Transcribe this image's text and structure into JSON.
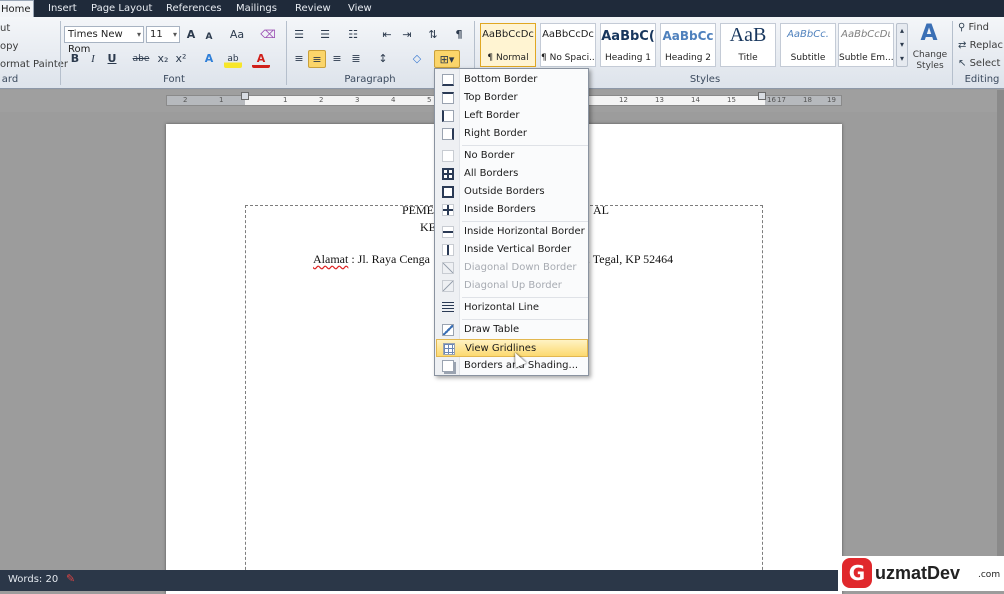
{
  "tabs": [
    "Home",
    "Insert",
    "Page Layout",
    "References",
    "Mailings",
    "Review",
    "View"
  ],
  "clipboard": {
    "cut": "ut",
    "copy": "opy",
    "format_painter": "ormat Painter",
    "label": "ard"
  },
  "font": {
    "name": "Times New Rom",
    "size": "11",
    "label": "Font",
    "bold": "B",
    "italic": "I",
    "underline": "U",
    "strike": "abe",
    "sub": "x₂",
    "sup": "x²",
    "grow": "A",
    "shrink": "A",
    "change_case": "Aa",
    "clear": "A",
    "highlight": "ab",
    "color": "A"
  },
  "paragraph": {
    "label": "Paragraph",
    "pilcrow": "¶"
  },
  "styles": {
    "label": "Styles",
    "items": [
      {
        "preview": "AaBbCcDc",
        "name": "¶ Normal"
      },
      {
        "preview": "AaBbCcDc",
        "name": "¶ No Spaci..."
      },
      {
        "preview": "AaBbC(",
        "name": "Heading 1"
      },
      {
        "preview": "AaBbCc",
        "name": "Heading 2"
      },
      {
        "preview": "AaB",
        "name": "Title"
      },
      {
        "preview": "AaBbCc.",
        "name": "Subtitle"
      },
      {
        "preview": "AaBbCcDι",
        "name": "Subtle Em..."
      }
    ],
    "change_styles": "Change Styles"
  },
  "editing": {
    "label": "Editing",
    "find": "Find",
    "replace": "Replac",
    "select": "Select"
  },
  "ruler_numbers": [
    "2",
    "1",
    "1",
    "2",
    "3",
    "4",
    "5",
    "6",
    "12",
    "13",
    "14",
    "15",
    "16",
    "17",
    "18",
    "19"
  ],
  "document": {
    "line1_left": "PEME",
    "line1_right": "AL",
    "line2_left": "KE",
    "line3_left": "Alamat",
    "line3_mid": " : Jl. Raya Cenga",
    "line3_right": "b. Tegal, KP 52464"
  },
  "border_menu": {
    "items": [
      {
        "label": "Bottom Border",
        "enabled": true
      },
      {
        "label": "Top Border",
        "enabled": true
      },
      {
        "label": "Left Border",
        "enabled": true
      },
      {
        "label": "Right Border",
        "enabled": true
      },
      {
        "label": "No Border",
        "enabled": true
      },
      {
        "label": "All Borders",
        "enabled": true
      },
      {
        "label": "Outside Borders",
        "enabled": true
      },
      {
        "label": "Inside Borders",
        "enabled": true
      },
      {
        "label": "Inside Horizontal Border",
        "enabled": true
      },
      {
        "label": "Inside Vertical Border",
        "enabled": true
      },
      {
        "label": "Diagonal Down Border",
        "enabled": false
      },
      {
        "label": "Diagonal Up Border",
        "enabled": false
      },
      {
        "label": "Horizontal Line",
        "enabled": true
      },
      {
        "label": "Draw Table",
        "enabled": true
      },
      {
        "label": "View Gridlines",
        "enabled": true,
        "highlighted": true
      },
      {
        "label": "Borders and Shading...",
        "enabled": true
      }
    ]
  },
  "status": {
    "words": "Words: 20"
  },
  "brand": {
    "logo_letter": "G",
    "name": "uzmatDev",
    "domain": ".com"
  },
  "colors": {
    "accent": "#fcd970",
    "titlebar": "#1f2a3a",
    "statusbar": "#2b3748"
  }
}
